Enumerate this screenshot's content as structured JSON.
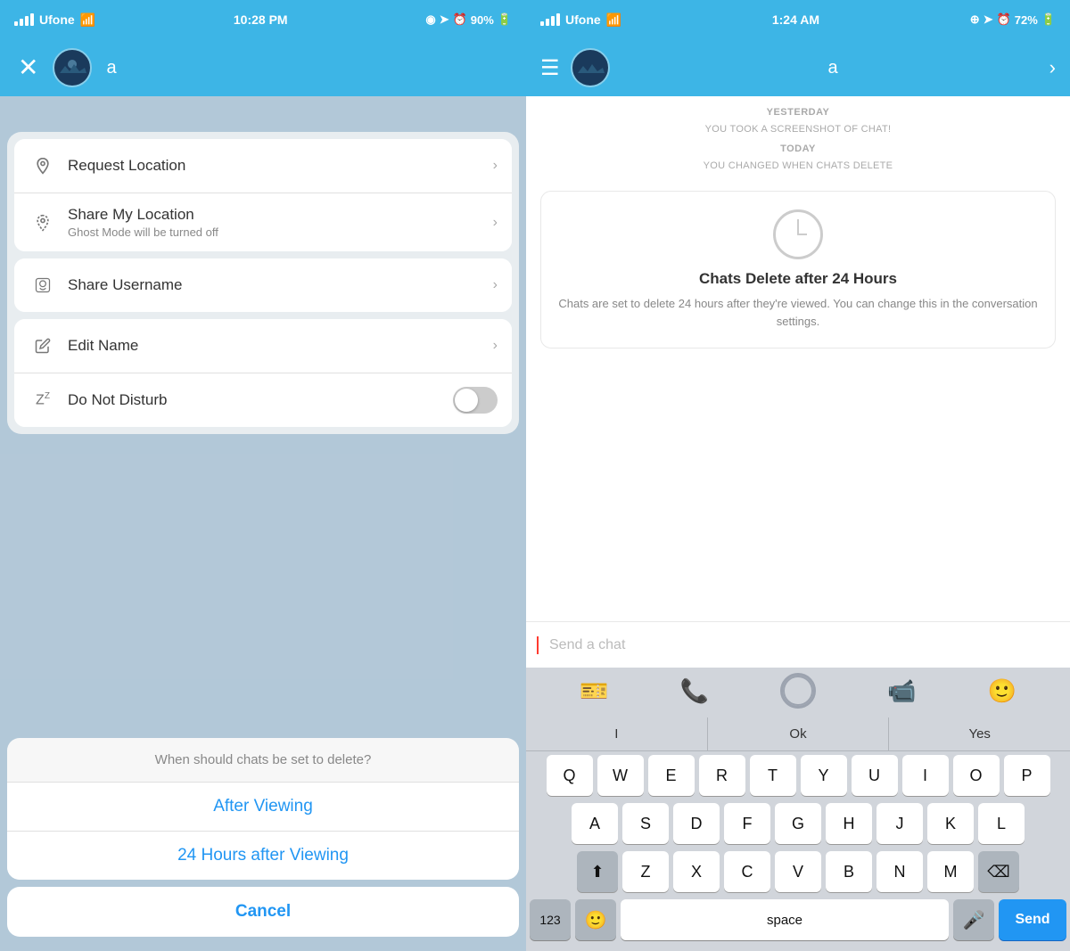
{
  "left": {
    "statusBar": {
      "carrier": "Ufone",
      "time": "10:28 PM",
      "battery": "90%"
    },
    "topBar": {
      "username": "a"
    },
    "menuItems": [
      {
        "id": "request-location",
        "icon": "📍",
        "title": "Request Location",
        "subtitle": ""
      },
      {
        "id": "share-location",
        "icon": "📍",
        "title": "Share My Location",
        "subtitle": "Ghost Mode will be turned off"
      },
      {
        "id": "share-username",
        "icon": "🔔",
        "title": "Share Username",
        "subtitle": ""
      },
      {
        "id": "edit-name",
        "icon": "✏️",
        "title": "Edit Name",
        "subtitle": ""
      },
      {
        "id": "do-not-disturb",
        "icon": "💤",
        "title": "Do Not Disturb",
        "subtitle": ""
      }
    ],
    "actionSheet": {
      "title": "When should chats be set to delete?",
      "options": [
        "After Viewing",
        "24 Hours after Viewing"
      ],
      "cancel": "Cancel"
    }
  },
  "right": {
    "statusBar": {
      "carrier": "Ufone",
      "time": "1:24 AM",
      "battery": "72%"
    },
    "topBar": {
      "username": "a"
    },
    "notifications": [
      {
        "label": "YESTERDAY",
        "text": "YOU TOOK A SCREENSHOT OF CHAT!"
      },
      {
        "label": "TODAY",
        "text": "YOU CHANGED WHEN CHATS DELETE"
      }
    ],
    "chatCard": {
      "title": "Chats Delete after 24 Hours",
      "description": "Chats are set to delete 24 hours after they're viewed. You can change this in the conversation settings."
    },
    "inputPlaceholder": "Send a chat",
    "keyboard": {
      "quicktype": [
        "I",
        "Ok",
        "Yes"
      ],
      "row1": [
        "Q",
        "W",
        "E",
        "R",
        "T",
        "Y",
        "U",
        "I",
        "O",
        "P"
      ],
      "row2": [
        "A",
        "S",
        "D",
        "F",
        "G",
        "H",
        "J",
        "K",
        "L"
      ],
      "row3": [
        "Z",
        "X",
        "C",
        "V",
        "B",
        "N",
        "M"
      ],
      "space": "space",
      "send": "Send"
    }
  }
}
